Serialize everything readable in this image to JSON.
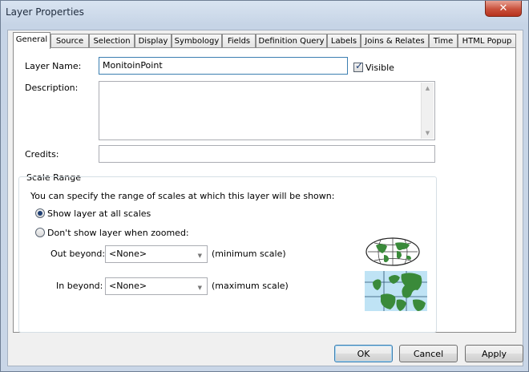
{
  "window": {
    "title": "Layer Properties",
    "close_icon": "close-icon"
  },
  "tabs": [
    {
      "label": "General",
      "active": true
    },
    {
      "label": "Source"
    },
    {
      "label": "Selection"
    },
    {
      "label": "Display"
    },
    {
      "label": "Symbology"
    },
    {
      "label": "Fields"
    },
    {
      "label": "Definition Query"
    },
    {
      "label": "Labels"
    },
    {
      "label": "Joins & Relates"
    },
    {
      "label": "Time"
    },
    {
      "label": "HTML Popup"
    }
  ],
  "general": {
    "layer_name_label": "Layer Name:",
    "layer_name_value": "MonitoinPoint",
    "visible_label": "Visible",
    "visible_checked": true,
    "description_label": "Description:",
    "description_value": "",
    "credits_label": "Credits:",
    "credits_value": ""
  },
  "scale_range": {
    "title": "Scale Range",
    "intro": "You can specify the range of scales at which this layer will be shown:",
    "option_all": "Show layer at all scales",
    "option_zoomed": "Don't show layer when zoomed:",
    "selected": "all",
    "out_beyond_label": "Out beyond:",
    "out_beyond_value": "<None>",
    "out_beyond_hint": "(minimum scale)",
    "in_beyond_label": "In beyond:",
    "in_beyond_value": "<None>",
    "in_beyond_hint": "(maximum scale)",
    "small_scale_icon": "world-globe-icon",
    "large_scale_icon": "europe-map-icon"
  },
  "buttons": {
    "ok": "OK",
    "cancel": "Cancel",
    "apply": "Apply"
  },
  "colors": {
    "ocean": "#bfe3f5",
    "land": "#3a8a3a",
    "focus": "#3c7fb1"
  }
}
